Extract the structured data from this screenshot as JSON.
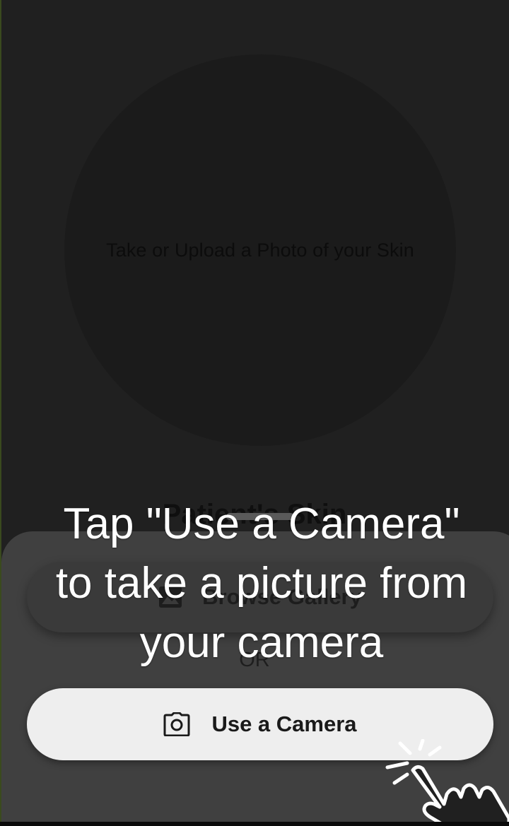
{
  "photo_area": {
    "placeholder": "Take or Upload a Photo of your Skin"
  },
  "section": {
    "title": "Patient's Skin"
  },
  "sheet": {
    "gallery_button_label": "Browse Gallery",
    "or_label": "OR",
    "camera_button_label": "Use a Camera"
  },
  "tutorial": {
    "line1": "Tap \"Use a Camera\"",
    "line2": "to take a picture from",
    "line3": "your camera"
  },
  "icons": {
    "gallery": "image-icon",
    "camera": "camera-icon",
    "pointer": "tap-hand-icon"
  },
  "colors": {
    "overlay": "#202020",
    "sheet": "#404040",
    "camera_button": "#eeeeee",
    "tutorial_text": "#ffffff"
  }
}
